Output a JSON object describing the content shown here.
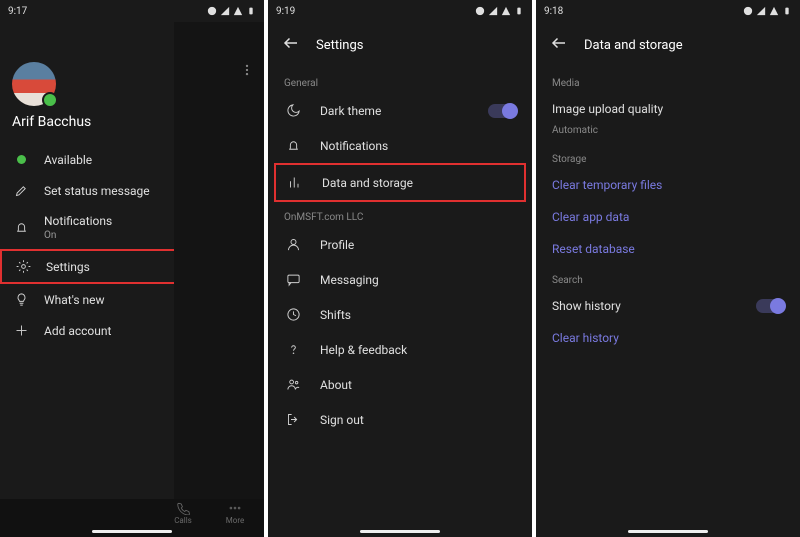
{
  "screen1": {
    "time": "9:17",
    "user_name": "Arif Bacchus",
    "status_label": "Available",
    "menu": {
      "set_status": "Set status message",
      "notifications": "Notifications",
      "notifications_sub": "On",
      "settings": "Settings",
      "whats_new": "What's new",
      "add_account": "Add account"
    },
    "nav": {
      "calls": "Calls",
      "more": "More"
    }
  },
  "screen2": {
    "time": "9:19",
    "title": "Settings",
    "general_section": "General",
    "dark_theme": "Dark theme",
    "notifications": "Notifications",
    "data_storage": "Data and storage",
    "org_section": "OnMSFT.com LLC",
    "profile": "Profile",
    "messaging": "Messaging",
    "shifts": "Shifts",
    "help": "Help & feedback",
    "about": "About",
    "sign_out": "Sign out"
  },
  "screen3": {
    "time": "9:18",
    "title": "Data and storage",
    "media_section": "Media",
    "image_quality": "Image upload quality",
    "image_quality_sub": "Automatic",
    "storage_section": "Storage",
    "clear_temp": "Clear temporary files",
    "clear_app": "Clear app data",
    "reset_db": "Reset database",
    "search_section": "Search",
    "show_history": "Show history",
    "clear_history": "Clear history"
  }
}
